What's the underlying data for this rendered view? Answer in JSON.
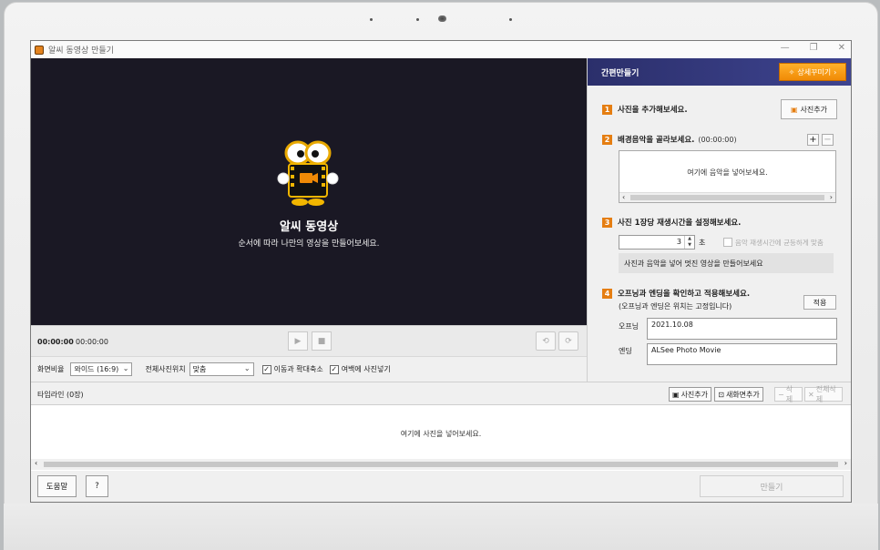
{
  "window": {
    "title": "알씨 동영상 만들기",
    "controls": [
      "—",
      "❐",
      "✕"
    ]
  },
  "preview": {
    "title": "알씨 동영상",
    "subtitle": "순서에 따라 나만의 영상을 만들어보세요."
  },
  "playback": {
    "current_time": "00:00:00",
    "total_time": "00:00:00"
  },
  "options": {
    "ratio_label": "화면비율",
    "ratio_value": "와이드 (16:9)",
    "position_label": "전체사진위치",
    "position_value": "맞춤",
    "move_zoom_label": "이동과 확대축소",
    "move_zoom_checked": true,
    "fill_blank_label": "여백에 사진넣기",
    "fill_blank_checked": true
  },
  "panel": {
    "title": "간편만들기",
    "detail_button": "상세꾸미기",
    "step1": {
      "num": "1",
      "text": "사진을 추가해보세요.",
      "button": "사진추가"
    },
    "step2": {
      "num": "2",
      "text": "배경음악을 골라보세요.",
      "duration": "(00:00:00)",
      "hint": "여기에 음악을 넣어보세요."
    },
    "step3": {
      "num": "3",
      "text": "사진 1장당 재생시간을 설정해보세요.",
      "seconds": "3",
      "unit": "초",
      "sync_label": "음악 재생시간에 균등하게 맞춤",
      "info": "사진과 음악을 넣어 멋진 영상을 만들어보세요"
    },
    "step4": {
      "num": "4",
      "text": "오프닝과 엔딩을 확인하고 적용해보세요.",
      "note": "(오프닝과 엔딩은 위치는 고정입니다)",
      "apply_button": "적용",
      "opening_label": "오프닝",
      "opening_value": "2021.10.08",
      "ending_label": "엔딩",
      "ending_value": "ALSee Photo Movie"
    }
  },
  "timeline": {
    "title": "타임라인 (0장)",
    "add_photo": "사진추가",
    "add_new_screen": "새화면추가",
    "delete": "삭제",
    "delete_all": "전체삭제",
    "hint": "여기에 사진을 넣어보세요."
  },
  "footer": {
    "help": "도움말",
    "question": "?",
    "make": "만들기"
  },
  "colors": {
    "accent_orange": "#e57e12",
    "panel_header": "#2b2f6b",
    "preview_bg": "#1a1824"
  },
  "icons": [
    "app-icon",
    "play-icon",
    "stop-icon",
    "rewind-icon",
    "forward-icon",
    "wand-icon",
    "chevron-right-icon",
    "photo-add-icon",
    "screen-add-icon",
    "plus-icon",
    "minus-icon",
    "close-icon"
  ]
}
